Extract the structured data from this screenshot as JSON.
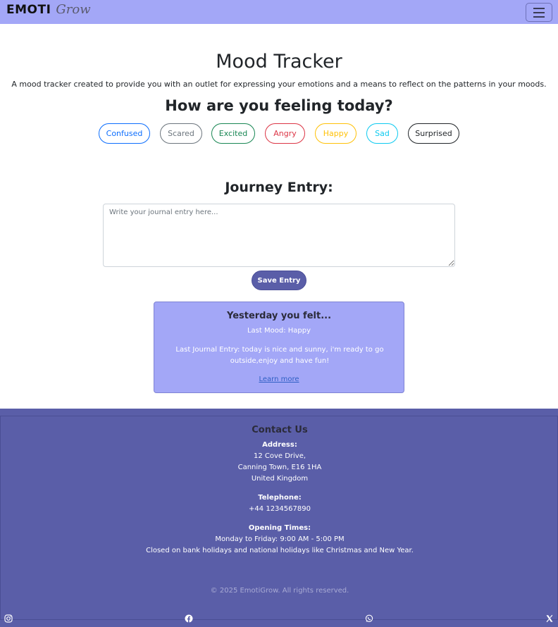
{
  "navbar": {
    "brand_main": "EMOTI",
    "brand_script": "Grow",
    "bg_color": "#a3a7f7"
  },
  "main": {
    "title": "Mood Tracker",
    "subtitle": "A mood tracker created to provide you with an outlet for expressing your emotions and a means to reflect on the patterns in your moods.",
    "question": "How are you feeling today?",
    "moods": [
      {
        "label": "Confused",
        "color": "#0d6efd"
      },
      {
        "label": "Scared",
        "color": "#6c757d"
      },
      {
        "label": "Excited",
        "color": "#198754"
      },
      {
        "label": "Angry",
        "color": "#dc3545"
      },
      {
        "label": "Happy",
        "color": "#ffc107"
      },
      {
        "label": "Sad",
        "color": "#0dcaf0"
      },
      {
        "label": "Surprised",
        "color": "#212529"
      }
    ],
    "entry_label": "Journey Entry:",
    "journal_placeholder": "Write your journal entry here...",
    "save_label": "Save Entry"
  },
  "card": {
    "title": "Yesterday you felt...",
    "last_mood": "Last Mood: Happy",
    "last_entry": "Last Journal Entry: today is nice and sunny, i'm ready to go outside,enjoy and have fun!",
    "link": "Learn more"
  },
  "footer": {
    "contact_title": "Contact Us",
    "address_label": "Address:",
    "address_lines": [
      "12 Cove Drive,",
      "Canning Town, E16 1HA",
      "United Kingdom"
    ],
    "telephone_label": "Telephone:",
    "telephone": "+44 1234567890",
    "hours_label": "Opening Times:",
    "hours": "Monday to Friday: 9:00 AM - 5:00 PM",
    "holidays": "Closed on bank holidays and national holidays like Christmas and New Year.",
    "copyright": "© 2025 EmotiGrow. All rights reserved.",
    "bg_color": "#5a5ea8",
    "social_icons": [
      "instagram-icon",
      "facebook-icon",
      "whatsapp-icon",
      "x-icon"
    ]
  }
}
